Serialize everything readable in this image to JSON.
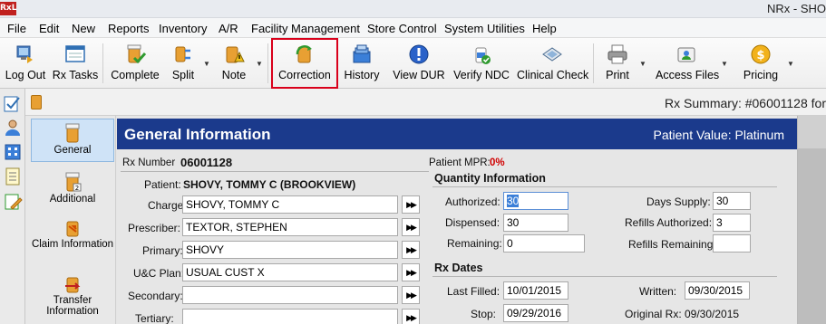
{
  "window": {
    "app_icon": "RxL",
    "title": "NRx - SHO"
  },
  "menu": [
    "File",
    "Edit",
    "New",
    "Reports",
    "Inventory",
    "A/R",
    "Facility Management",
    "Store Control",
    "System Utilities",
    "Help"
  ],
  "toolbar": {
    "log_out": "Log Out",
    "rx_tasks": "Rx Tasks",
    "complete": "Complete",
    "split": "Split",
    "note": "Note",
    "correction": "Correction",
    "history": "History",
    "view_dur": "View DUR",
    "verify_ndc": "Verify NDC",
    "clinical_check": "Clinical Check",
    "print": "Print",
    "access_files": "Access Files",
    "pricing": "Pricing"
  },
  "rx_window": {
    "title": "Rx Summary: #06001128 for"
  },
  "nav": {
    "general": "General",
    "additional": "Additional",
    "claim_info": "Claim Information",
    "transfer_info": "Transfer Information"
  },
  "general_info": {
    "title": "General Information",
    "patient_value": "Patient Value: Platinum",
    "rx_number_label": "Rx Number",
    "rx_number": "06001128",
    "mpr_label": "Patient MPR:",
    "mpr_value": "0%",
    "patient_label": "Patient:",
    "patient_value_name": "SHOVY, TOMMY C (BROOKVIEW)",
    "charge_label": "Charge:",
    "charge": "SHOVY, TOMMY C",
    "prescriber_label": "Prescriber:",
    "prescriber": "TEXTOR, STEPHEN",
    "primary_label": "Primary:",
    "primary": "SHOVY",
    "uc_plan_label": "U&C Plan:",
    "uc_plan": "USUAL CUST X",
    "secondary_label": "Secondary:",
    "secondary": "",
    "tertiary_label": "Tertiary:",
    "tertiary": ""
  },
  "quantity_info": {
    "title": "Quantity Information",
    "authorized_label": "Authorized:",
    "authorized": "30",
    "dispensed_label": "Dispensed:",
    "dispensed": "30",
    "remaining_label": "Remaining:",
    "remaining": "0",
    "days_supply_label": "Days Supply:",
    "days_supply": "30",
    "refills_authorized_label": "Refills Authorized:",
    "refills_authorized": "3",
    "refills_remaining_label": "Refills Remaining:",
    "refills_remaining": ""
  },
  "rx_dates": {
    "title": "Rx Dates",
    "last_filled_label": "Last Filled:",
    "last_filled": "10/01/2015",
    "stop_label": "Stop:",
    "stop": "09/29/2016",
    "written_label": "Written:",
    "written": "09/30/2015",
    "original_rx_label": "Original Rx:",
    "original_rx": "09/30/2015"
  },
  "colors": {
    "header_bg": "#1b3a8c",
    "highlight_border": "#d9001b",
    "mpr_red": "#d00000"
  }
}
